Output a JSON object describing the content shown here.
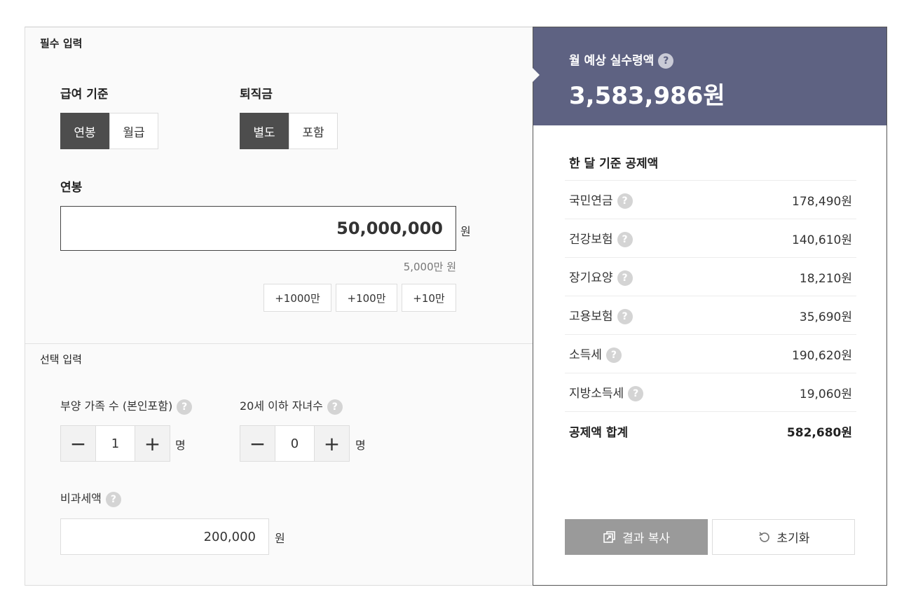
{
  "required": {
    "title": "필수 입력",
    "pay_basis": {
      "label": "급여 기준",
      "options": [
        "연봉",
        "월급"
      ],
      "selected": "연봉"
    },
    "severance": {
      "label": "퇴직금",
      "options": [
        "별도",
        "포함"
      ],
      "selected": "별도"
    },
    "salary": {
      "label": "연봉",
      "value": "50,000,000",
      "unit": "원",
      "hint": "5,000만 원"
    },
    "increments": [
      "+1000만",
      "+100만",
      "+10만"
    ]
  },
  "optional": {
    "title": "선택 입력",
    "dependents": {
      "label": "부양 가족 수 (본인포함)",
      "minus": "−",
      "value": "1",
      "plus": "+",
      "unit": "명"
    },
    "children": {
      "label": "20세 이하 자녀수",
      "minus": "−",
      "value": "0",
      "plus": "+",
      "unit": "명"
    },
    "nontaxable": {
      "label": "비과세액",
      "value": "200,000",
      "unit": "원"
    }
  },
  "result": {
    "label": "월 예상 실수령액",
    "help": "?",
    "amount": "3,583,986원",
    "deductions_title": "한 달 기준 공제액",
    "deductions": [
      {
        "name": "국민연금",
        "amount": "178,490원"
      },
      {
        "name": "건강보험",
        "amount": "140,610원"
      },
      {
        "name": "장기요양",
        "amount": "18,210원"
      },
      {
        "name": "고용보험",
        "amount": "35,690원"
      },
      {
        "name": "소득세",
        "amount": "190,620원"
      },
      {
        "name": "지방소득세",
        "amount": "19,060원"
      }
    ],
    "total": {
      "name": "공제액 합계",
      "amount": "582,680원"
    },
    "copy_label": "결과 복사",
    "reset_label": "초기화"
  },
  "colors": {
    "hero_bg": "#5e6282",
    "selected_toggle": "#4d4d4d",
    "copy_button": "#9a9a9a"
  },
  "icons": {
    "help": "question-circle-icon",
    "copy": "copy-icon",
    "reset": "refresh-icon"
  }
}
